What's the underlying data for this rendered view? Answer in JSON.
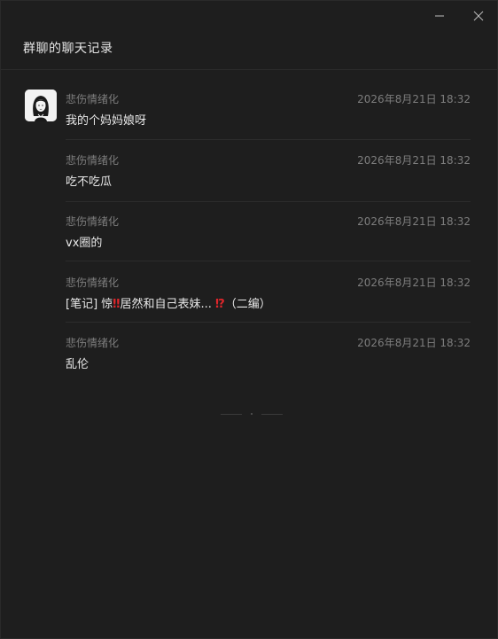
{
  "window": {
    "minimize_icon": "minimize-icon",
    "close_icon": "close-icon"
  },
  "header": {
    "title": "群聊的聊天记录"
  },
  "messages": [
    {
      "sender": "悲伤情绪化",
      "time": "2026年8月21日 18:32",
      "content": "我的个妈妈娘呀"
    },
    {
      "sender": "悲伤情绪化",
      "time": "2026年8月21日 18:32",
      "content": "吃不吃瓜"
    },
    {
      "sender": "悲伤情绪化",
      "time": "2026年8月21日 18:32",
      "content": "vx圈的"
    },
    {
      "sender": "悲伤情绪化",
      "time": "2026年8月21日 18:32",
      "content_parts": {
        "p1": "[笔记] 惊",
        "p2": "‼",
        "p3": "居然和自己表妹... ",
        "p4": "⁉",
        "p5": "（二编）"
      }
    },
    {
      "sender": "悲伤情绪化",
      "time": "2026年8月21日 18:32",
      "content": "乱伦"
    }
  ],
  "colors": {
    "background": "#1e1e1e",
    "meta_text": "#7d7d7d",
    "body_text": "#e8e8e8",
    "emoji_red": "#e0262b"
  }
}
